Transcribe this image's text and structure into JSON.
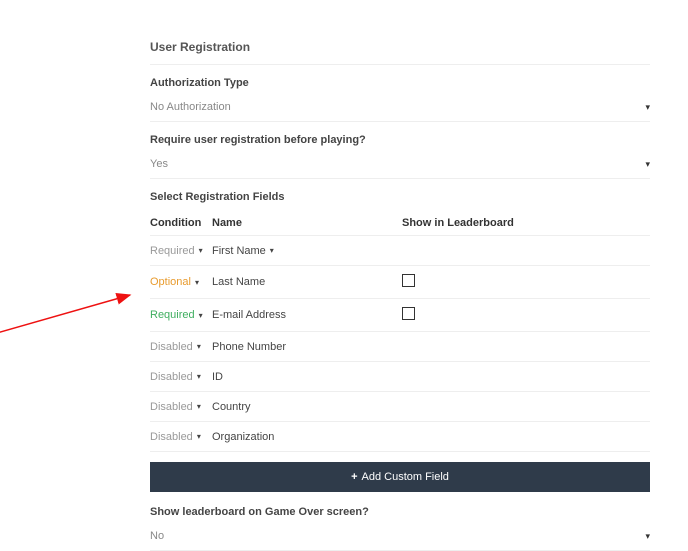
{
  "title": "User Registration",
  "auth": {
    "label": "Authorization Type",
    "value": "No Authorization"
  },
  "requireReg": {
    "label": "Require user registration before playing?",
    "value": "Yes"
  },
  "fieldsHeading": "Select Registration Fields",
  "columns": {
    "condition": "Condition",
    "name": "Name",
    "show": "Show in Leaderboard"
  },
  "rows": [
    {
      "cond": "Required",
      "condClass": "cond-required-gray",
      "name": "First Name",
      "nameCaret": true,
      "checkbox": false
    },
    {
      "cond": "Optional",
      "condClass": "cond-optional",
      "name": "Last Name",
      "nameCaret": false,
      "checkbox": true
    },
    {
      "cond": "Required",
      "condClass": "cond-required-green",
      "name": "E-mail Address",
      "nameCaret": false,
      "checkbox": true
    },
    {
      "cond": "Disabled",
      "condClass": "cond-disabled",
      "name": "Phone Number",
      "nameCaret": false,
      "checkbox": false
    },
    {
      "cond": "Disabled",
      "condClass": "cond-disabled",
      "name": "ID",
      "nameCaret": false,
      "checkbox": false
    },
    {
      "cond": "Disabled",
      "condClass": "cond-disabled",
      "name": "Country",
      "nameCaret": false,
      "checkbox": false
    },
    {
      "cond": "Disabled",
      "condClass": "cond-disabled",
      "name": "Organization",
      "nameCaret": false,
      "checkbox": false
    }
  ],
  "addButton": "Add Custom Field",
  "leaderboard": {
    "label": "Show leaderboard on Game Over screen?",
    "value": "No"
  }
}
